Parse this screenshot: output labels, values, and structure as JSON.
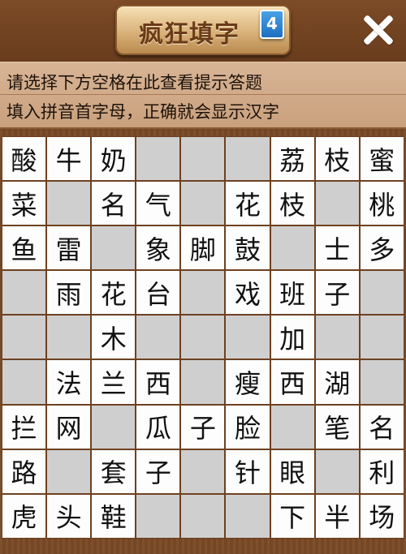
{
  "header": {
    "title": "疯狂填字",
    "level": "4",
    "close_icon": "close-icon"
  },
  "hints": {
    "line1": "请选择下方空格在此查看提示答题",
    "line2": "填入拼音首字母，正确就会显示汉字"
  },
  "grid": {
    "rows": [
      [
        "酸",
        "牛",
        "奶",
        "#",
        "#",
        "#",
        "荔",
        "枝",
        "蜜"
      ],
      [
        "菜",
        "_",
        "名",
        "气",
        "_",
        "花",
        "枝",
        "_",
        "桃"
      ],
      [
        "鱼",
        "雷",
        "_",
        "象",
        "脚",
        "鼓",
        "_",
        "士",
        "多"
      ],
      [
        "_",
        "雨",
        "花",
        "台",
        "_",
        "戏",
        "班",
        "子",
        "_"
      ],
      [
        "_",
        "_",
        "木",
        "_",
        "_",
        "_",
        "加",
        "_",
        "_"
      ],
      [
        "_",
        "法",
        "兰",
        "西",
        "_",
        "瘦",
        "西",
        "湖",
        "_"
      ],
      [
        "拦",
        "网",
        "_",
        "瓜",
        "子",
        "脸",
        "_",
        "笔",
        "名"
      ],
      [
        "路",
        "_",
        "套",
        "子",
        "_",
        "针",
        "眼",
        "_",
        "利"
      ],
      [
        "虎",
        "头",
        "鞋",
        "#",
        "#",
        "_",
        "下",
        "半",
        "场"
      ]
    ]
  },
  "colors": {
    "wood": "#6e4120",
    "open_cell": "#fdfdfd",
    "blocked_cell": "#cfcfcf",
    "hint_panel": "#d0a986"
  }
}
